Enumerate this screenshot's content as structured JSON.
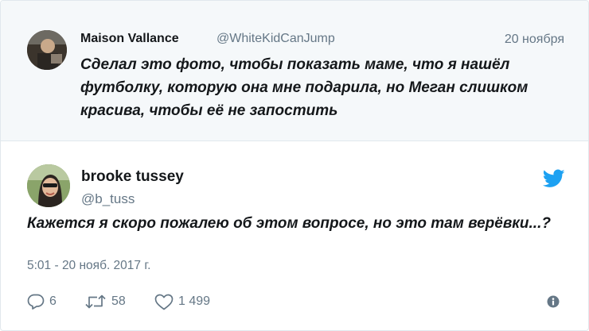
{
  "quoted_tweet": {
    "author_name": "Maison Vallance",
    "author_handle": "@WhiteKidCanJump",
    "date": "20 ноября",
    "text": "Сделал это фото, чтобы показать маме, что я нашёл футболку, которую она мне подарила, но Меган слишком красива, чтобы её не запостить"
  },
  "main_tweet": {
    "author_name": "brooke tussey",
    "author_handle": "@b_tuss",
    "text": "Кажется я скоро пожалею об этом вопросе, но это там верёвки...?",
    "timestamp": "5:01 - 20 нояб. 2017 г."
  },
  "actions": {
    "replies": "6",
    "retweets": "58",
    "likes": "1 499"
  },
  "colors": {
    "twitter_blue": "#1da1f2",
    "secondary_text": "#657786",
    "quoted_background": "#f5f8fa"
  },
  "icons": [
    "twitter-bird-icon",
    "reply-icon",
    "retweet-icon",
    "like-icon",
    "info-icon"
  ]
}
